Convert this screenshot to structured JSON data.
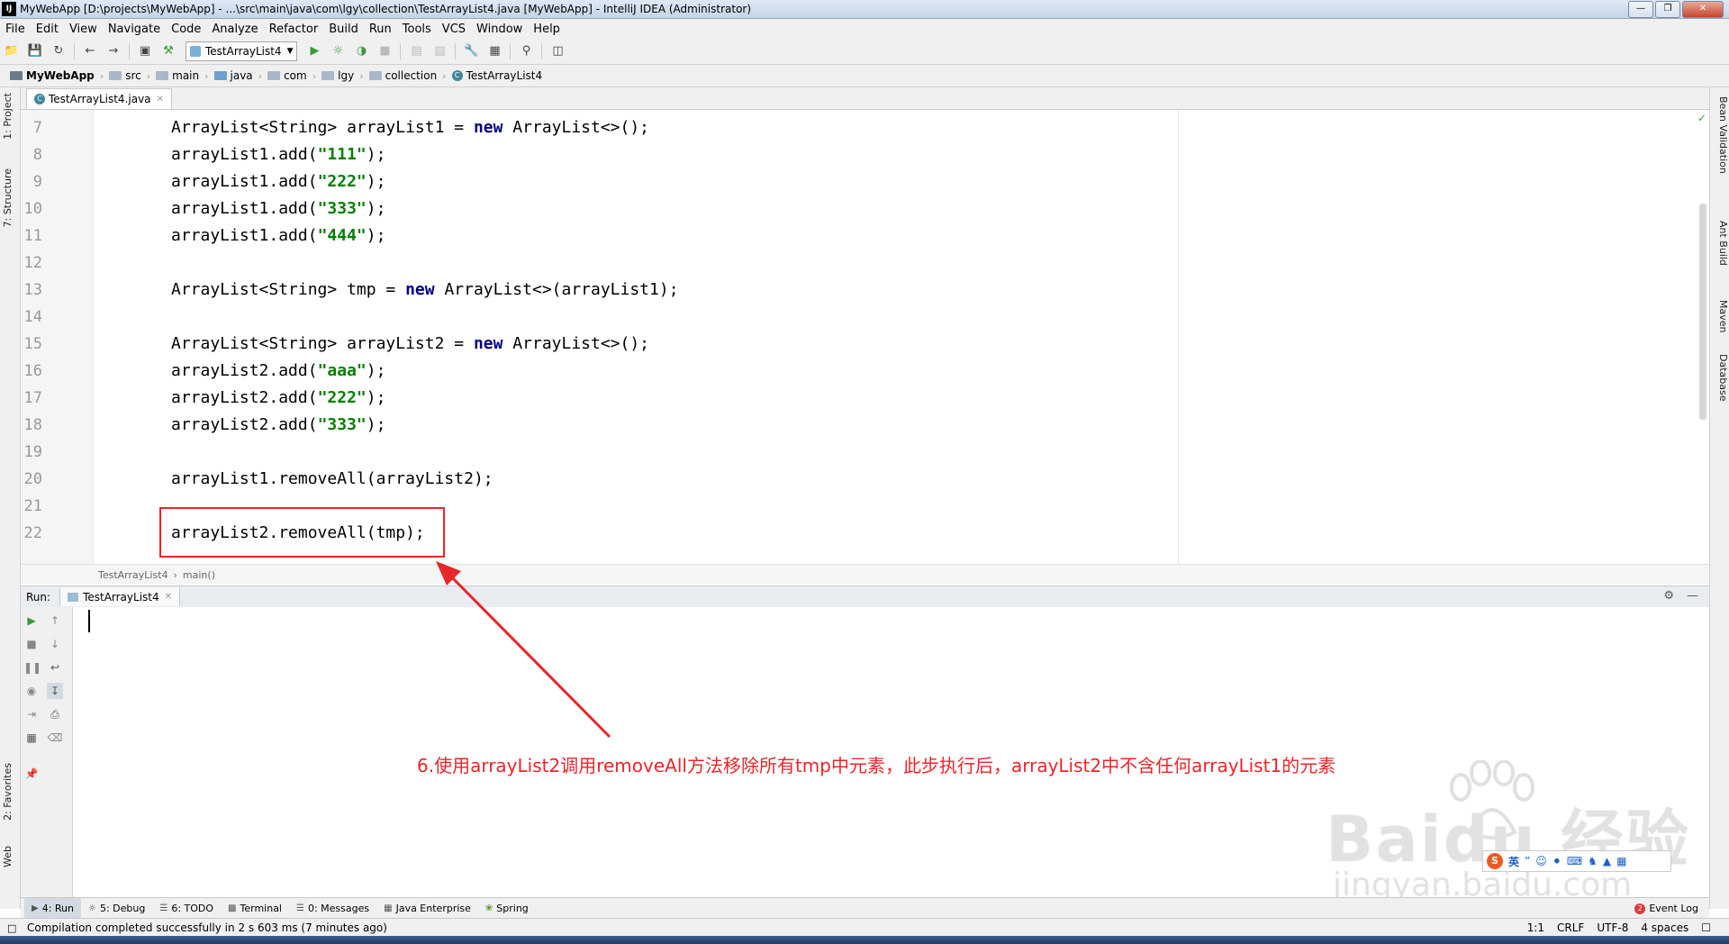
{
  "window": {
    "title": "MyWebApp [D:\\projects\\MyWebApp] - ...\\src\\main\\java\\com\\lgy\\collection\\TestArrayList4.java [MyWebApp] - IntelliJ IDEA (Administrator)",
    "logo": "IJ"
  },
  "menu": [
    "File",
    "Edit",
    "View",
    "Navigate",
    "Code",
    "Analyze",
    "Refactor",
    "Build",
    "Run",
    "Tools",
    "VCS",
    "Window",
    "Help"
  ],
  "toolbar": {
    "run_config": "TestArrayList4"
  },
  "breadcrumbs": [
    "MyWebApp",
    "src",
    "main",
    "java",
    "com",
    "lgy",
    "collection",
    "TestArrayList4"
  ],
  "editor": {
    "tab": "TestArrayList4.java",
    "lines": [
      {
        "num": "7",
        "code": "ArrayList<String> arrayList1 = new ArrayList<>();"
      },
      {
        "num": "8",
        "code": "arrayList1.add(\"111\");"
      },
      {
        "num": "9",
        "code": "arrayList1.add(\"222\");"
      },
      {
        "num": "10",
        "code": "arrayList1.add(\"333\");"
      },
      {
        "num": "11",
        "code": "arrayList1.add(\"444\");"
      },
      {
        "num": "12",
        "code": ""
      },
      {
        "num": "13",
        "code": "ArrayList<String> tmp = new ArrayList<>(arrayList1);"
      },
      {
        "num": "14",
        "code": ""
      },
      {
        "num": "15",
        "code": "ArrayList<String> arrayList2 = new ArrayList<>();"
      },
      {
        "num": "16",
        "code": "arrayList2.add(\"aaa\");"
      },
      {
        "num": "17",
        "code": "arrayList2.add(\"222\");"
      },
      {
        "num": "18",
        "code": "arrayList2.add(\"333\");"
      },
      {
        "num": "19",
        "code": ""
      },
      {
        "num": "20",
        "code": "arrayList1.removeAll(arrayList2);"
      },
      {
        "num": "21",
        "code": ""
      },
      {
        "num": "22",
        "code": "arrayList2.removeAll(tmp);"
      }
    ],
    "status_class": "TestArrayList4",
    "status_method": "main()"
  },
  "left_tabs": [
    "1: Project",
    "7: Structure",
    "2: Favorites",
    "Web"
  ],
  "right_tabs": [
    "Bean Validation",
    "Ant Build",
    "Maven",
    "Database"
  ],
  "run_panel": {
    "label": "Run:",
    "tab": "TestArrayList4"
  },
  "annotation": "6.使用arrayList2调用removeAll方法移除所有tmp中元素，此步执行后，arrayList2中不含任何arrayList1的元素",
  "bottom_tabs": [
    "4: Run",
    "5: Debug",
    "6: TODO",
    "Terminal",
    "0: Messages",
    "Java Enterprise",
    "Spring"
  ],
  "event_log": {
    "count": "2",
    "label": "Event Log"
  },
  "status": {
    "message": "Compilation completed successfully in 2 s 603 ms (7 minutes ago)",
    "position": "1:1",
    "line_sep": "CRLF",
    "encoding": "UTF-8",
    "indent": "4 spaces"
  },
  "watermark": {
    "main": "Baidu 经验",
    "sub": "jingyan.baidu.com"
  },
  "ime": {
    "char": "英"
  },
  "colors": {
    "annotation": "#e8262a",
    "keyword": "#000080",
    "string": "#008000"
  }
}
